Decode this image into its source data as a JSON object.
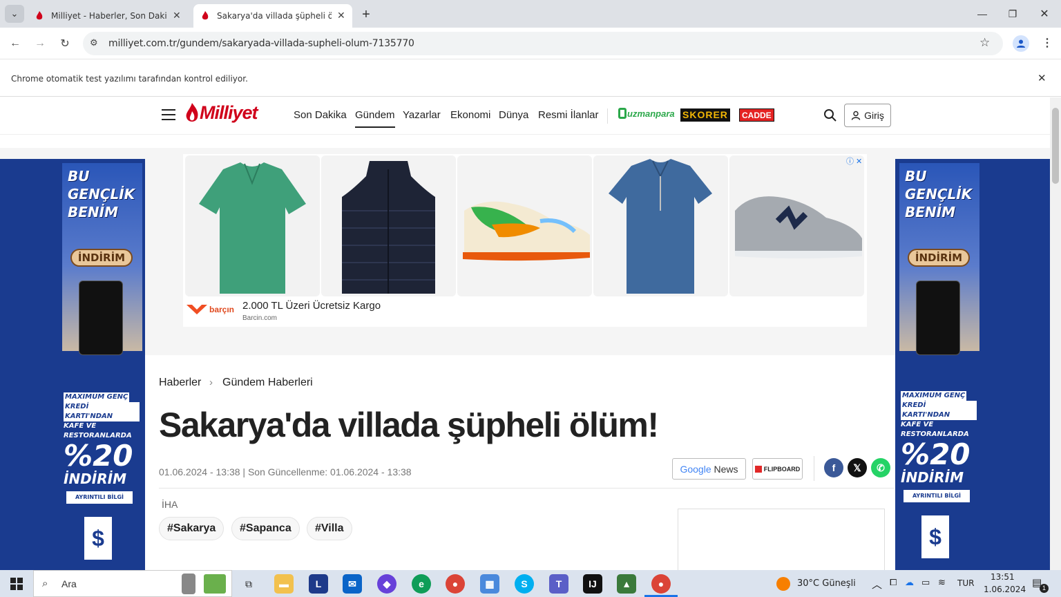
{
  "browser": {
    "tabs": [
      {
        "title": "Milliyet - Haberler, Son Dakika Haberler",
        "active": false
      },
      {
        "title": "Sakarya'da villada şüpheli ölüm!",
        "active": true
      }
    ],
    "new_tab_label": "+",
    "url": "milliyet.com.tr/gundem/sakaryada-villada-supheli-olum-7135770",
    "infobar_text": "Chrome otomatik test yazılımı tarafından kontrol ediliyor."
  },
  "site": {
    "logo": "Milliyet",
    "nav": [
      "Son Dakika",
      "Gündem",
      "Yazarlar",
      "Ekonomi",
      "Dünya",
      "Resmi İlanlar"
    ],
    "active_nav": "Gündem",
    "partner_brands": [
      "uzmanpara",
      "SKORER",
      "CADDE"
    ],
    "login_label": "Giriş"
  },
  "ad_main": {
    "brand": "barçın",
    "headline": "2.000 TL Üzeri Ücretsiz Kargo",
    "domain": "Barcin.com"
  },
  "side_ad": {
    "lines1": [
      "BU",
      "GENÇLİK",
      "BENİM"
    ],
    "badge": "İNDİRİM",
    "lines2": [
      "MAXIMUM GENÇ",
      "KREDİ KARTI'NDAN",
      "KAFE VE",
      "RESTORANLARDA"
    ],
    "big": "%20",
    "big2": "İNDİRİM",
    "button": "AYRINTILI BİLGİ"
  },
  "article": {
    "breadcrumb": [
      "Haberler",
      "Gündem Haberleri"
    ],
    "headline": "Sakarya'da villada şüpheli ölüm!",
    "dateline": "01.06.2024 - 13:38 | Son Güncellenme: 01.06.2024 - 13:38",
    "google_news": {
      "google": "Google",
      "news": "News"
    },
    "flipboard": "FLIPBOARD",
    "source": "İHA",
    "tags": [
      "#Sakarya",
      "#Sapanca",
      "#Villa"
    ]
  },
  "taskbar": {
    "search_placeholder": "Ara",
    "weather": "30°C  Güneşli",
    "lang": "TUR",
    "time": "13:51",
    "date": "1.06.2024",
    "notif_count": "1"
  },
  "colors": {
    "brand_red": "#d0021b",
    "tab_strip": "#dee1e6",
    "side_ad_blue": "#1a3b8f"
  }
}
